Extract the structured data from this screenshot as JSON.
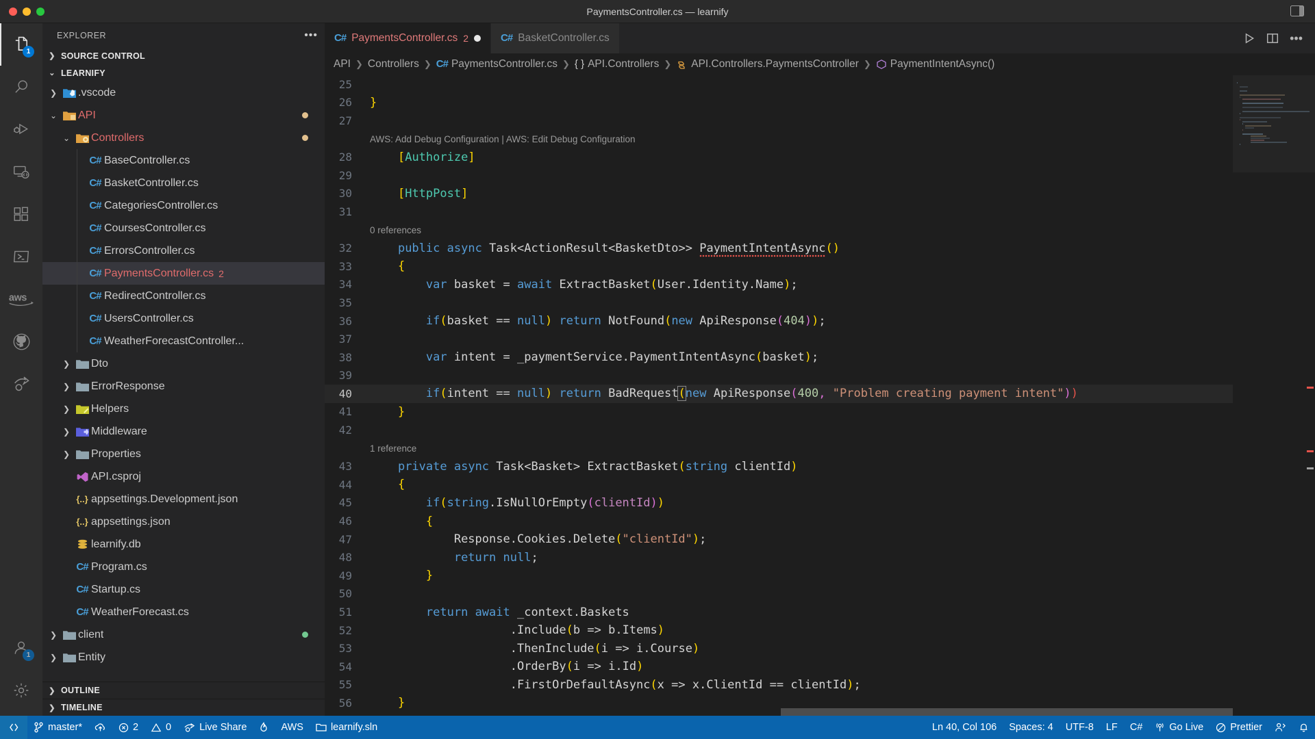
{
  "window": {
    "title": "PaymentsController.cs — learnify",
    "traffic_lights": [
      "close",
      "minimize",
      "maximize"
    ],
    "layout_icon": "customize-layout-icon"
  },
  "activitybar": {
    "items": [
      {
        "name": "explorer",
        "icon": "files-icon",
        "badge": "1",
        "active": true
      },
      {
        "name": "search",
        "icon": "search-icon",
        "badge": "",
        "active": false
      },
      {
        "name": "run-and-debug",
        "icon": "debug-icon",
        "badge": "",
        "active": false
      },
      {
        "name": "remote-explorer",
        "icon": "remote-icon",
        "badge": "",
        "active": false
      },
      {
        "name": "extensions",
        "icon": "extensions-icon",
        "badge": "",
        "active": false
      },
      {
        "name": "terminal-powershell",
        "icon": "powershell-icon",
        "badge": "",
        "active": false
      },
      {
        "name": "aws-toolkit",
        "icon": "aws-icon",
        "badge": "",
        "active": false
      },
      {
        "name": "github",
        "icon": "github-icon",
        "badge": "",
        "active": false
      },
      {
        "name": "live-share",
        "icon": "live-share-icon",
        "badge": "",
        "active": false
      }
    ],
    "bottom": [
      {
        "name": "accounts",
        "icon": "account-icon",
        "badge": "1"
      },
      {
        "name": "manage",
        "icon": "gear-icon",
        "badge": ""
      }
    ]
  },
  "sidebar": {
    "header_title": "EXPLORER",
    "header_actions_icon": "more-actions-icon",
    "sections": [
      {
        "label": "SOURCE CONTROL",
        "expanded": false
      },
      {
        "label": "LEARNIFY",
        "expanded": true
      },
      {
        "label": "OUTLINE",
        "expanded": false
      },
      {
        "label": "TIMELINE",
        "expanded": false
      }
    ],
    "tree": [
      {
        "label": ".vscode",
        "type": "folder",
        "icon": "vscode-folder-icon",
        "depth": 1,
        "twisty": "collapsed",
        "color": "#cccccc",
        "folder_color": "#3c9ddd",
        "status": ""
      },
      {
        "label": "API",
        "type": "folder",
        "icon": "api-folder-icon",
        "depth": 1,
        "twisty": "expanded",
        "color": "#e06c6c",
        "folder_color": "#e0a040",
        "status": "modified"
      },
      {
        "label": "Controllers",
        "type": "folder",
        "icon": "controllers-folder-icon",
        "depth": 2,
        "twisty": "expanded",
        "color": "#e06c6c",
        "folder_color": "#e0a040",
        "status": "modified"
      },
      {
        "label": "BaseController.cs",
        "type": "file",
        "icon": "csharp-icon",
        "depth": 3,
        "twisty": "",
        "color": "#cccccc",
        "status": ""
      },
      {
        "label": "BasketController.cs",
        "type": "file",
        "icon": "csharp-icon",
        "depth": 3,
        "twisty": "",
        "color": "#cccccc",
        "status": ""
      },
      {
        "label": "CategoriesController.cs",
        "type": "file",
        "icon": "csharp-icon",
        "depth": 3,
        "twisty": "",
        "color": "#cccccc",
        "status": ""
      },
      {
        "label": "CoursesController.cs",
        "type": "file",
        "icon": "csharp-icon",
        "depth": 3,
        "twisty": "",
        "color": "#cccccc",
        "status": ""
      },
      {
        "label": "ErrorsController.cs",
        "type": "file",
        "icon": "csharp-icon",
        "depth": 3,
        "twisty": "",
        "color": "#cccccc",
        "status": ""
      },
      {
        "label": "PaymentsController.cs",
        "type": "file",
        "icon": "csharp-icon",
        "depth": 3,
        "twisty": "",
        "color": "#e06c6c",
        "status": "",
        "count": "2",
        "selected": true
      },
      {
        "label": "RedirectController.cs",
        "type": "file",
        "icon": "csharp-icon",
        "depth": 3,
        "twisty": "",
        "color": "#cccccc",
        "status": ""
      },
      {
        "label": "UsersController.cs",
        "type": "file",
        "icon": "csharp-icon",
        "depth": 3,
        "twisty": "",
        "color": "#cccccc",
        "status": ""
      },
      {
        "label": "WeatherForecastController...",
        "type": "file",
        "icon": "csharp-icon",
        "depth": 3,
        "twisty": "",
        "color": "#cccccc",
        "status": ""
      },
      {
        "label": "Dto",
        "type": "folder",
        "icon": "folder-icon",
        "depth": 2,
        "twisty": "collapsed",
        "color": "#cccccc",
        "folder_color": "#90a4ae",
        "status": ""
      },
      {
        "label": "ErrorResponse",
        "type": "folder",
        "icon": "folder-icon",
        "depth": 2,
        "twisty": "collapsed",
        "color": "#cccccc",
        "folder_color": "#90a4ae",
        "status": ""
      },
      {
        "label": "Helpers",
        "type": "folder",
        "icon": "helpers-folder-icon",
        "depth": 2,
        "twisty": "collapsed",
        "color": "#cccccc",
        "folder_color": "#c5c72b",
        "status": ""
      },
      {
        "label": "Middleware",
        "type": "folder",
        "icon": "middleware-folder-icon",
        "depth": 2,
        "twisty": "collapsed",
        "color": "#cccccc",
        "folder_color": "#5b5fdd",
        "status": ""
      },
      {
        "label": "Properties",
        "type": "folder",
        "icon": "folder-icon",
        "depth": 2,
        "twisty": "collapsed",
        "color": "#cccccc",
        "folder_color": "#90a4ae",
        "status": ""
      },
      {
        "label": "API.csproj",
        "type": "file",
        "icon": "visualstudio-icon",
        "depth": 2,
        "twisty": "",
        "color": "#cccccc",
        "status": ""
      },
      {
        "label": "appsettings.Development.json",
        "type": "file",
        "icon": "json-icon",
        "depth": 2,
        "twisty": "",
        "color": "#cccccc",
        "status": ""
      },
      {
        "label": "appsettings.json",
        "type": "file",
        "icon": "json-icon",
        "depth": 2,
        "twisty": "",
        "color": "#cccccc",
        "status": ""
      },
      {
        "label": "learnify.db",
        "type": "file",
        "icon": "database-icon",
        "depth": 2,
        "twisty": "",
        "color": "#cccccc",
        "status": ""
      },
      {
        "label": "Program.cs",
        "type": "file",
        "icon": "csharp-icon",
        "depth": 2,
        "twisty": "",
        "color": "#cccccc",
        "status": ""
      },
      {
        "label": "Startup.cs",
        "type": "file",
        "icon": "csharp-icon",
        "depth": 2,
        "twisty": "",
        "color": "#cccccc",
        "status": ""
      },
      {
        "label": "WeatherForecast.cs",
        "type": "file",
        "icon": "csharp-icon",
        "depth": 2,
        "twisty": "",
        "color": "#cccccc",
        "status": ""
      },
      {
        "label": "client",
        "type": "folder",
        "icon": "folder-icon",
        "depth": 1,
        "twisty": "collapsed",
        "color": "#cccccc",
        "folder_color": "#90a4ae",
        "status": "untracked"
      },
      {
        "label": "Entity",
        "type": "folder",
        "icon": "folder-icon",
        "depth": 1,
        "twisty": "collapsed",
        "color": "#cccccc",
        "folder_color": "#90a4ae",
        "status": ""
      }
    ]
  },
  "editor": {
    "tabs": [
      {
        "label": "PaymentsController.cs",
        "icon": "csharp-icon",
        "error_count": "2",
        "modified": true,
        "active": true
      },
      {
        "label": "BasketController.cs",
        "icon": "csharp-icon",
        "error_count": "",
        "modified": false,
        "active": false
      }
    ],
    "tab_actions": [
      {
        "name": "run-button",
        "icon": "play-icon"
      },
      {
        "name": "split-editor-button",
        "icon": "split-editor-icon"
      },
      {
        "name": "more-actions-button",
        "icon": "ellipsis-icon"
      }
    ],
    "breadcrumb": [
      {
        "label": "API",
        "icon": ""
      },
      {
        "label": "Controllers",
        "icon": ""
      },
      {
        "label": "PaymentsController.cs",
        "icon": "csharp-icon"
      },
      {
        "label": "API.Controllers",
        "icon": "namespace-icon"
      },
      {
        "label": "API.Controllers.PaymentsController",
        "icon": "class-icon"
      },
      {
        "label": "PaymentIntentAsync()",
        "icon": "method-icon"
      }
    ],
    "codelens": [
      {
        "after_line": "27",
        "text": "AWS: Add Debug Configuration | AWS: Edit Debug Configuration"
      },
      {
        "after_line": "31",
        "text": "0 references"
      },
      {
        "after_line": "42",
        "text": "1 reference"
      }
    ],
    "first_visible_line": "25",
    "lines": [
      {
        "n": "25",
        "text": ""
      },
      {
        "n": "26",
        "text": "}"
      },
      {
        "n": "27",
        "text": ""
      },
      {
        "n": "28",
        "text": "    [Authorize]"
      },
      {
        "n": "29",
        "text": ""
      },
      {
        "n": "30",
        "text": "    [HttpPost]"
      },
      {
        "n": "31",
        "text": ""
      },
      {
        "n": "32",
        "text": "    public async Task<ActionResult<BasketDto>> PaymentIntentAsync()"
      },
      {
        "n": "33",
        "text": "    {"
      },
      {
        "n": "34",
        "text": "        var basket = await ExtractBasket(User.Identity.Name);"
      },
      {
        "n": "35",
        "text": ""
      },
      {
        "n": "36",
        "text": "        if(basket == null) return NotFound(new ApiResponse(404));"
      },
      {
        "n": "37",
        "text": ""
      },
      {
        "n": "38",
        "text": "        var intent = _paymentService.PaymentIntentAsync(basket);"
      },
      {
        "n": "39",
        "text": ""
      },
      {
        "n": "40",
        "text": "        if(intent == null) return BadRequest(new ApiResponse(400, \"Problem creating payment intent\"))"
      },
      {
        "n": "41",
        "text": "    }"
      },
      {
        "n": "42",
        "text": ""
      },
      {
        "n": "43",
        "text": "    private async Task<Basket> ExtractBasket(string clientId)"
      },
      {
        "n": "44",
        "text": "    {"
      },
      {
        "n": "45",
        "text": "        if(string.IsNullOrEmpty(clientId))"
      },
      {
        "n": "46",
        "text": "        {"
      },
      {
        "n": "47",
        "text": "            Response.Cookies.Delete(\"clientId\");"
      },
      {
        "n": "48",
        "text": "            return null;"
      },
      {
        "n": "49",
        "text": "        }"
      },
      {
        "n": "50",
        "text": ""
      },
      {
        "n": "51",
        "text": "        return await _context.Baskets"
      },
      {
        "n": "52",
        "text": "                    .Include(b => b.Items)"
      },
      {
        "n": "53",
        "text": "                    .ThenInclude(i => i.Course)"
      },
      {
        "n": "54",
        "text": "                    .OrderBy(i => i.Id)"
      },
      {
        "n": "55",
        "text": "                    .FirstOrDefaultAsync(x => x.ClientId == clientId);"
      },
      {
        "n": "56",
        "text": "    }"
      }
    ],
    "active_line": "40",
    "minimap_visible": true
  },
  "statusbar": {
    "left": [
      {
        "name": "remote-indicator",
        "icon": "remote-icon",
        "label": ""
      },
      {
        "name": "branch",
        "icon": "source-control-icon",
        "label": "master*"
      },
      {
        "name": "sync-changes",
        "icon": "cloud-upload-icon",
        "label": ""
      },
      {
        "name": "problems-errors",
        "icon": "error-icon",
        "label": "2"
      },
      {
        "name": "problems-warnings",
        "icon": "warning-icon",
        "label": "0"
      },
      {
        "name": "live-share",
        "icon": "live-share-icon",
        "label": "Live Share"
      },
      {
        "name": "hot-reload",
        "icon": "flame-icon",
        "label": ""
      },
      {
        "name": "aws-connection",
        "icon": "",
        "label": "AWS"
      },
      {
        "name": "solution",
        "icon": "folder-icon",
        "label": "learnify.sln"
      }
    ],
    "right": [
      {
        "name": "cursor-position",
        "icon": "",
        "label": "Ln 40, Col 106"
      },
      {
        "name": "indentation",
        "icon": "",
        "label": "Spaces: 4"
      },
      {
        "name": "encoding",
        "icon": "",
        "label": "UTF-8"
      },
      {
        "name": "eol",
        "icon": "",
        "label": "LF"
      },
      {
        "name": "language-mode",
        "icon": "",
        "label": "C#"
      },
      {
        "name": "go-live",
        "icon": "broadcast-icon",
        "label": "Go Live"
      },
      {
        "name": "prettier",
        "icon": "prettier-icon",
        "label": "Prettier"
      },
      {
        "name": "feedback",
        "icon": "feedback-icon",
        "label": ""
      },
      {
        "name": "notifications",
        "icon": "bell-icon",
        "label": ""
      }
    ]
  },
  "colors": {
    "accent_blue": "#0a64ad",
    "badge_blue": "#0078d4",
    "error_red": "#e06c6c",
    "editor_bg": "#1e1e1e",
    "sidebar_bg": "#252526",
    "activitybar_bg": "#2d2d2d"
  }
}
